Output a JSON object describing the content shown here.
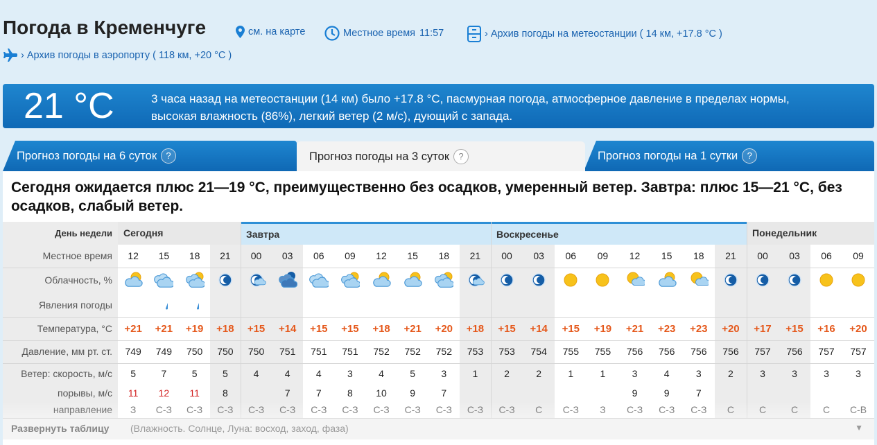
{
  "header": {
    "title": "Погода в Кременчуге",
    "map_link": "см. на карте",
    "local_time_label": "Местное время",
    "local_time": "11:57",
    "station_archive": "› Архив погоды на метеостанции ( 14 км, +17.8 °C )",
    "airport_archive": "› Архив погоды в аэропорту ( 118 км, +20 °C )"
  },
  "current": {
    "temp": "21 °C",
    "description": "3 часа назад на метеостанции (14 км) было +17.8 °C, пасмурная погода, атмосферное давление в пределах нормы, высокая влажность (86%), легкий ветер (2 м/с), дующий с запада."
  },
  "tabs": [
    {
      "label": "Прогноз погоды на 6 суток",
      "active": false
    },
    {
      "label": "Прогноз погоды на 3 суток",
      "active": true
    },
    {
      "label": "Прогноз погоды на 1 сутки",
      "active": false
    }
  ],
  "tab_help": "?",
  "summary": "Сегодня ожидается плюс 21—19 °C, преимущественно без осадков, умеренный ветер. Завтра: плюс 15—21 °C, без осадков, слабый ветер.",
  "table": {
    "labels": {
      "day": "День недели",
      "time": "Местное время",
      "cloud": "Облачность, %",
      "phenomena": "Явления погоды",
      "temp": "Температура, °C",
      "pressure": "Давление, мм рт. ст.",
      "wind": "Ветер: скорость, м/с",
      "gust": "порывы, м/с",
      "dir": "направление"
    },
    "days": [
      {
        "name": "Сегодня",
        "start": 0,
        "span": 4,
        "style": "gray"
      },
      {
        "name": "Завтра",
        "start": 4,
        "span": 8,
        "style": "blue"
      },
      {
        "name": "Воскресенье",
        "start": 12,
        "span": 8,
        "style": "blue"
      },
      {
        "name": "Понедельник",
        "start": 20,
        "span": 4,
        "style": "gray"
      }
    ],
    "columns": [
      {
        "time": "12",
        "icon": "partly-cloudy-day-icon",
        "temp": "+21",
        "pressure": "749",
        "wind": "5",
        "gust": "11",
        "gust_red": true,
        "dir": "З",
        "night": false
      },
      {
        "time": "15",
        "icon": "cloudy-icon",
        "rain": true,
        "temp": "+21",
        "pressure": "749",
        "wind": "7",
        "gust": "12",
        "gust_red": true,
        "dir": "С-З",
        "night": false
      },
      {
        "time": "18",
        "icon": "mostly-cloudy-day-icon",
        "rain": true,
        "temp": "+19",
        "pressure": "750",
        "wind": "5",
        "gust": "11",
        "gust_red": true,
        "dir": "С-З",
        "night": false
      },
      {
        "time": "21",
        "icon": "clear-night-icon",
        "temp": "+18",
        "pressure": "750",
        "wind": "5",
        "gust": "8",
        "gust_red": false,
        "dir": "С-З",
        "night": true
      },
      {
        "time": "00",
        "icon": "partly-cloudy-night-icon",
        "temp": "+15",
        "pressure": "750",
        "wind": "4",
        "gust": "",
        "gust_red": false,
        "dir": "С-З",
        "night": true
      },
      {
        "time": "03",
        "icon": "cloudy-night-icon",
        "temp": "+14",
        "pressure": "751",
        "wind": "4",
        "gust": "7",
        "gust_red": false,
        "dir": "С-З",
        "night": true
      },
      {
        "time": "06",
        "icon": "cloudy-icon",
        "temp": "+15",
        "pressure": "751",
        "wind": "4",
        "gust": "7",
        "gust_red": false,
        "dir": "С-З",
        "night": false
      },
      {
        "time": "09",
        "icon": "mostly-cloudy-day-icon",
        "temp": "+15",
        "pressure": "751",
        "wind": "3",
        "gust": "8",
        "gust_red": false,
        "dir": "С-З",
        "night": false
      },
      {
        "time": "12",
        "icon": "partly-cloudy-day-icon",
        "temp": "+18",
        "pressure": "752",
        "wind": "4",
        "gust": "10",
        "gust_red": false,
        "dir": "С-З",
        "night": false
      },
      {
        "time": "15",
        "icon": "partly-cloudy-day-icon",
        "temp": "+21",
        "pressure": "752",
        "wind": "5",
        "gust": "9",
        "gust_red": false,
        "dir": "С-З",
        "night": false
      },
      {
        "time": "18",
        "icon": "mostly-cloudy-day-icon",
        "temp": "+20",
        "pressure": "752",
        "wind": "3",
        "gust": "7",
        "gust_red": false,
        "dir": "С-З",
        "night": false
      },
      {
        "time": "21",
        "icon": "partly-cloudy-night-icon",
        "temp": "+18",
        "pressure": "753",
        "wind": "1",
        "gust": "",
        "gust_red": false,
        "dir": "С-З",
        "night": true
      },
      {
        "time": "00",
        "icon": "clear-night-icon",
        "temp": "+15",
        "pressure": "753",
        "wind": "2",
        "gust": "",
        "gust_red": false,
        "dir": "С-З",
        "night": true
      },
      {
        "time": "03",
        "icon": "clear-night-icon",
        "temp": "+14",
        "pressure": "754",
        "wind": "2",
        "gust": "",
        "gust_red": false,
        "dir": "С",
        "night": true
      },
      {
        "time": "06",
        "icon": "sun-icon",
        "temp": "+15",
        "pressure": "755",
        "wind": "1",
        "gust": "",
        "gust_red": false,
        "dir": "С-З",
        "night": false
      },
      {
        "time": "09",
        "icon": "sun-icon",
        "temp": "+19",
        "pressure": "755",
        "wind": "1",
        "gust": "",
        "gust_red": false,
        "dir": "З",
        "night": false
      },
      {
        "time": "12",
        "icon": "sun-cloud-icon",
        "temp": "+21",
        "pressure": "756",
        "wind": "3",
        "gust": "9",
        "gust_red": false,
        "dir": "С-З",
        "night": false
      },
      {
        "time": "15",
        "icon": "partly-cloudy-day-icon",
        "temp": "+23",
        "pressure": "756",
        "wind": "4",
        "gust": "9",
        "gust_red": false,
        "dir": "С-З",
        "night": false
      },
      {
        "time": "18",
        "icon": "sun-cloud-icon",
        "temp": "+23",
        "pressure": "756",
        "wind": "3",
        "gust": "7",
        "gust_red": false,
        "dir": "С-З",
        "night": false
      },
      {
        "time": "21",
        "icon": "clear-night-icon",
        "temp": "+20",
        "pressure": "756",
        "wind": "2",
        "gust": "",
        "gust_red": false,
        "dir": "С",
        "night": true
      },
      {
        "time": "00",
        "icon": "clear-night-icon",
        "temp": "+17",
        "pressure": "757",
        "wind": "3",
        "gust": "",
        "gust_red": false,
        "dir": "С",
        "night": true
      },
      {
        "time": "03",
        "icon": "clear-night-icon",
        "temp": "+15",
        "pressure": "756",
        "wind": "3",
        "gust": "",
        "gust_red": false,
        "dir": "С",
        "night": true
      },
      {
        "time": "06",
        "icon": "sun-icon",
        "temp": "+16",
        "pressure": "757",
        "wind": "3",
        "gust": "",
        "gust_red": false,
        "dir": "С",
        "night": false
      },
      {
        "time": "09",
        "icon": "sun-icon",
        "temp": "+20",
        "pressure": "757",
        "wind": "3",
        "gust": "",
        "gust_red": false,
        "dir": "С-В",
        "night": false
      }
    ]
  },
  "footer": {
    "expand": "Развернуть таблицу",
    "expand_hint": "(Влажность. Солнце, Луна: восход, заход, фаза)"
  },
  "colors": {
    "accent_blue": "#1a63b0",
    "banner_blue": "#0f69b6",
    "temp_orange": "#e5581b",
    "gust_red": "#d21f1f"
  }
}
